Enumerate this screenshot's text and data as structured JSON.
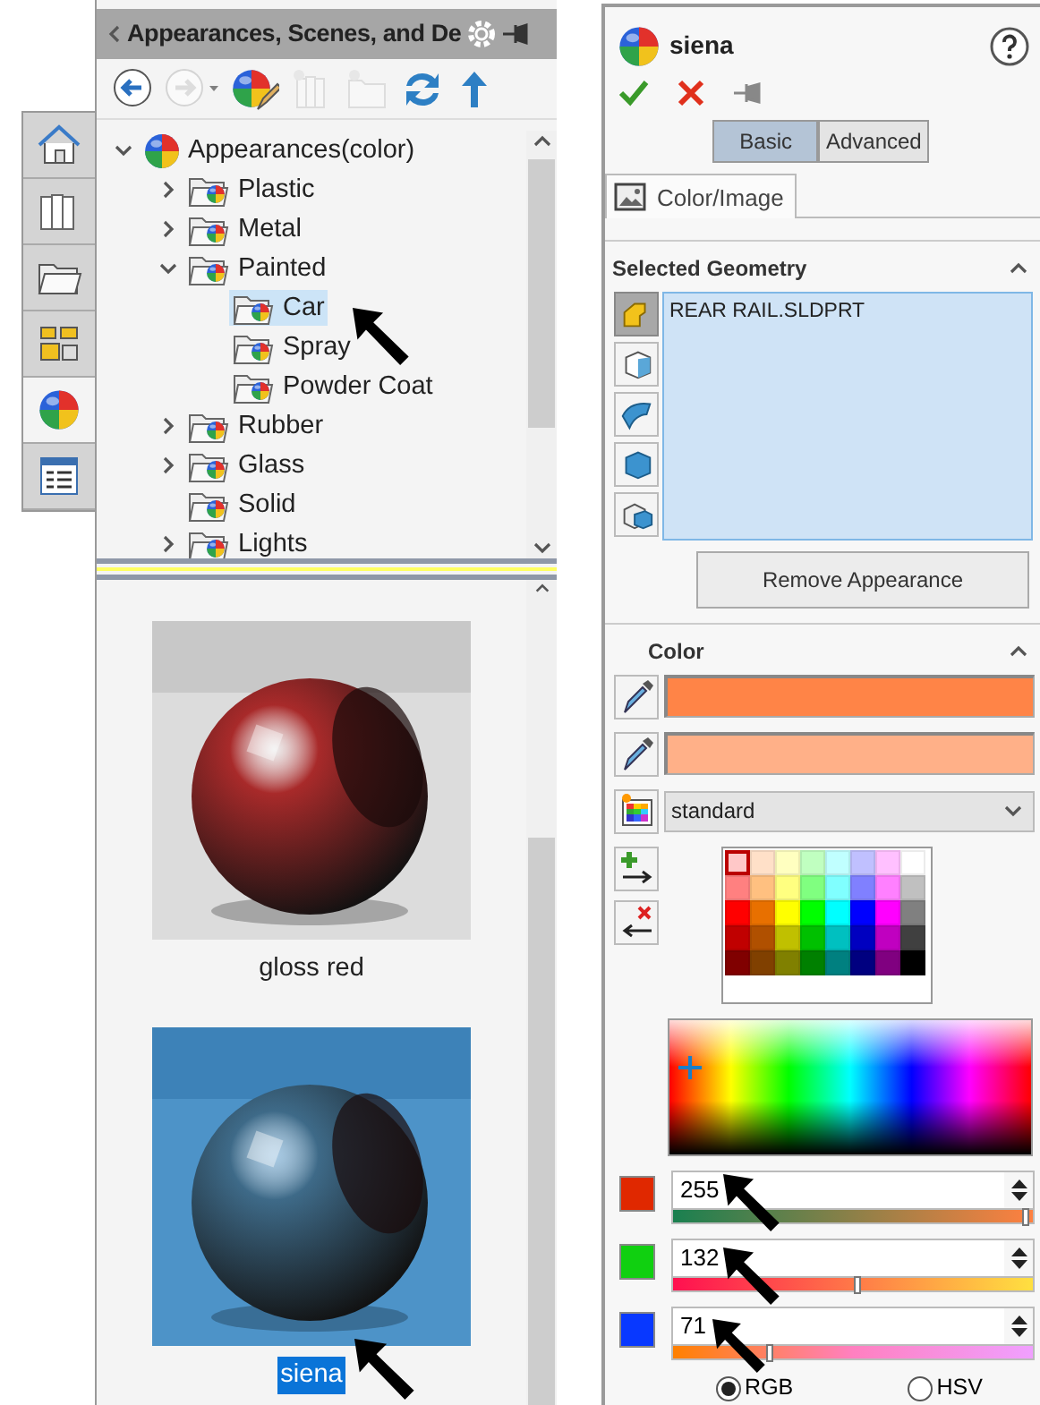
{
  "side_tabs": [
    {
      "kind": "home",
      "selected": false
    },
    {
      "kind": "library",
      "selected": false
    },
    {
      "kind": "folder",
      "selected": false
    },
    {
      "kind": "layout",
      "selected": false
    },
    {
      "kind": "appearances",
      "selected": true
    },
    {
      "kind": "list",
      "selected": false
    }
  ],
  "left_panel": {
    "title": "Appearances, Scenes, and De",
    "toolbar": [
      {
        "kind": "back",
        "disabled": false
      },
      {
        "kind": "forward",
        "disabled": true
      },
      {
        "kind": "edit-appearance",
        "disabled": false
      },
      {
        "kind": "add-library",
        "disabled": true
      },
      {
        "kind": "add-folder",
        "disabled": true
      },
      {
        "kind": "refresh",
        "disabled": false
      },
      {
        "kind": "up",
        "disabled": false
      }
    ],
    "tree": [
      {
        "label": "Appearances(color)",
        "kind": "root",
        "expanded": true,
        "selected": false,
        "children": [
          {
            "label": "Plastic",
            "kind": "branch",
            "expanded": false,
            "selected": false
          },
          {
            "label": "Metal",
            "kind": "branch",
            "expanded": false,
            "selected": false
          },
          {
            "label": "Painted",
            "kind": "branch",
            "expanded": true,
            "selected": false,
            "children": [
              {
                "label": "Car",
                "kind": "leaf",
                "selected": true
              },
              {
                "label": "Spray",
                "kind": "leaf",
                "selected": false
              },
              {
                "label": "Powder Coat",
                "kind": "leaf",
                "selected": false
              }
            ]
          },
          {
            "label": "Rubber",
            "kind": "branch",
            "expanded": false,
            "selected": false
          },
          {
            "label": "Glass",
            "kind": "branch",
            "expanded": false,
            "selected": false
          },
          {
            "label": "Solid",
            "kind": "leaf",
            "selected": false
          },
          {
            "label": "Lights",
            "kind": "branch",
            "expanded": false,
            "selected": false
          }
        ]
      }
    ],
    "gallery": [
      {
        "label": "gloss red",
        "color": "#a82a2a",
        "selected": false
      },
      {
        "label": "siena",
        "color": "#3e6a88",
        "selected": true
      }
    ]
  },
  "right_panel": {
    "title": "siena",
    "actions": [
      {
        "kind": "ok"
      },
      {
        "kind": "cancel"
      },
      {
        "kind": "pin"
      }
    ],
    "modes": [
      {
        "label": "Basic",
        "selected": true
      },
      {
        "label": "Advanced",
        "selected": false
      }
    ],
    "tabs": [
      {
        "label": "Color/Image",
        "selected": true
      }
    ],
    "selected_geometry": {
      "title": "Selected Geometry",
      "expanded": true,
      "filters": [
        {
          "kind": "part",
          "selected": true
        },
        {
          "kind": "face",
          "selected": false
        },
        {
          "kind": "surface",
          "selected": false
        },
        {
          "kind": "body",
          "selected": false
        },
        {
          "kind": "feature",
          "selected": false
        }
      ],
      "items": [
        "REAR RAIL.SLDPRT"
      ],
      "remove_button": "Remove Appearance"
    },
    "color": {
      "title": "Color",
      "expanded": true,
      "swatches": [
        {
          "color": "#ff8447"
        },
        {
          "color": "#ffb088"
        }
      ],
      "palette_name": "standard",
      "palette": [
        [
          {
            "color": "#ffc8c8",
            "selected": true
          },
          {
            "color": "#ffe0c8",
            "selected": false
          },
          {
            "color": "#ffffc0",
            "selected": false
          },
          {
            "color": "#c0ffc0",
            "selected": false
          },
          {
            "color": "#c0ffff",
            "selected": false
          },
          {
            "color": "#c0c0ff",
            "selected": false
          },
          {
            "color": "#ffc0ff",
            "selected": false
          },
          {
            "color": "#ffffff",
            "selected": false
          }
        ],
        [
          {
            "color": "#ff8080",
            "selected": false
          },
          {
            "color": "#ffc080",
            "selected": false
          },
          {
            "color": "#ffff80",
            "selected": false
          },
          {
            "color": "#80ff80",
            "selected": false
          },
          {
            "color": "#80ffff",
            "selected": false
          },
          {
            "color": "#8080ff",
            "selected": false
          },
          {
            "color": "#ff80ff",
            "selected": false
          },
          {
            "color": "#c0c0c0",
            "selected": false
          }
        ],
        [
          {
            "color": "#ff0000",
            "selected": false
          },
          {
            "color": "#e87000",
            "selected": false
          },
          {
            "color": "#ffff00",
            "selected": false
          },
          {
            "color": "#00ff00",
            "selected": false
          },
          {
            "color": "#00ffff",
            "selected": false
          },
          {
            "color": "#0000ff",
            "selected": false
          },
          {
            "color": "#ff00ff",
            "selected": false
          },
          {
            "color": "#808080",
            "selected": false
          }
        ],
        [
          {
            "color": "#c00000",
            "selected": false
          },
          {
            "color": "#b05000",
            "selected": false
          },
          {
            "color": "#c0c000",
            "selected": false
          },
          {
            "color": "#00c000",
            "selected": false
          },
          {
            "color": "#00c0c0",
            "selected": false
          },
          {
            "color": "#0000c0",
            "selected": false
          },
          {
            "color": "#c000c0",
            "selected": false
          },
          {
            "color": "#404040",
            "selected": false
          }
        ],
        [
          {
            "color": "#800000",
            "selected": false
          },
          {
            "color": "#804000",
            "selected": false
          },
          {
            "color": "#808000",
            "selected": false
          },
          {
            "color": "#008000",
            "selected": false
          },
          {
            "color": "#008080",
            "selected": false
          },
          {
            "color": "#000080",
            "selected": false
          },
          {
            "color": "#800080",
            "selected": false
          },
          {
            "color": "#000000",
            "selected": false
          }
        ]
      ],
      "channels": [
        {
          "color": "#e02800",
          "value": "255",
          "level": 1.0
        },
        {
          "color": "#10d010",
          "value": "132",
          "level": 0.52
        },
        {
          "color": "#0838ff",
          "value": "71",
          "level": 0.28
        }
      ],
      "spaces": [
        {
          "label": "RGB",
          "selected": true
        },
        {
          "label": "HSV",
          "selected": false
        }
      ]
    }
  }
}
